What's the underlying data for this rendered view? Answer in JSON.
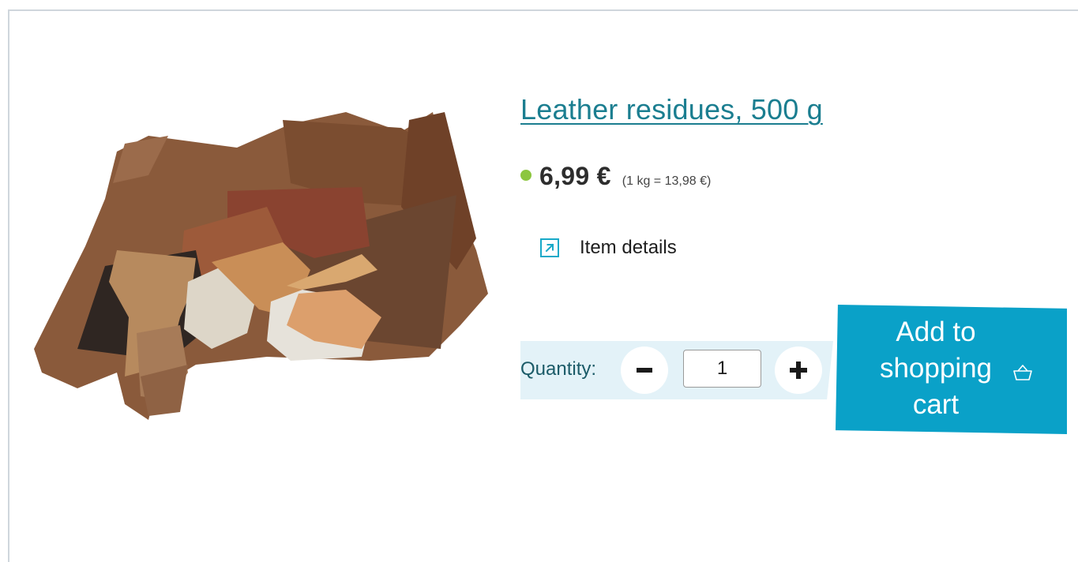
{
  "product": {
    "title": "Leather residues, 500 g",
    "price": "6,99 €",
    "unit_price": "(1 kg = 13,98 €)",
    "availability_color": "#8cc63f",
    "image_icon": "leather-scraps-photo"
  },
  "details": {
    "label": "Item details",
    "icon": "external-link-icon"
  },
  "quantity": {
    "label": "Quantity:",
    "value": "1",
    "decrement_icon": "minus-icon",
    "increment_icon": "plus-icon"
  },
  "cart": {
    "label": "Add to shopping cart",
    "icon": "basket-icon",
    "color": "#0aa1c8"
  },
  "colors": {
    "accent": "#18a9c8",
    "title": "#1b7e90",
    "quantity_bar": "#e3f2f8"
  }
}
